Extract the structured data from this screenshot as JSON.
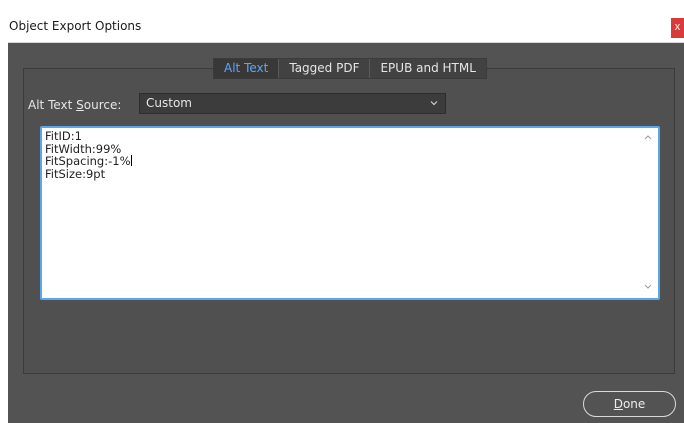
{
  "window": {
    "title": "Object Export Options",
    "close_label": "x"
  },
  "tabs": [
    {
      "label": "Alt Text",
      "active": true
    },
    {
      "label": "Tagged PDF",
      "active": false
    },
    {
      "label": "EPUB and HTML",
      "active": false
    }
  ],
  "alt_text": {
    "source_label_prefix": "Alt Text ",
    "source_label_mnemonic": "S",
    "source_label_suffix": "ource:",
    "source_value": "Custom",
    "lines": [
      "FitID:1",
      "FitWidth:99%",
      "FitSpacing:-1%",
      "FitSize:9pt"
    ]
  },
  "footer": {
    "done_mnemonic": "D",
    "done_rest": "one"
  },
  "colors": {
    "accent": "#5aa6ff",
    "background": "#535353",
    "close": "#d93a3a",
    "focus_border": "#5aa6e8"
  },
  "icons": {
    "chevron": "chevron-down-icon",
    "scroll_up": "scroll-up-arrow-icon",
    "scroll_down": "scroll-down-arrow-icon"
  }
}
